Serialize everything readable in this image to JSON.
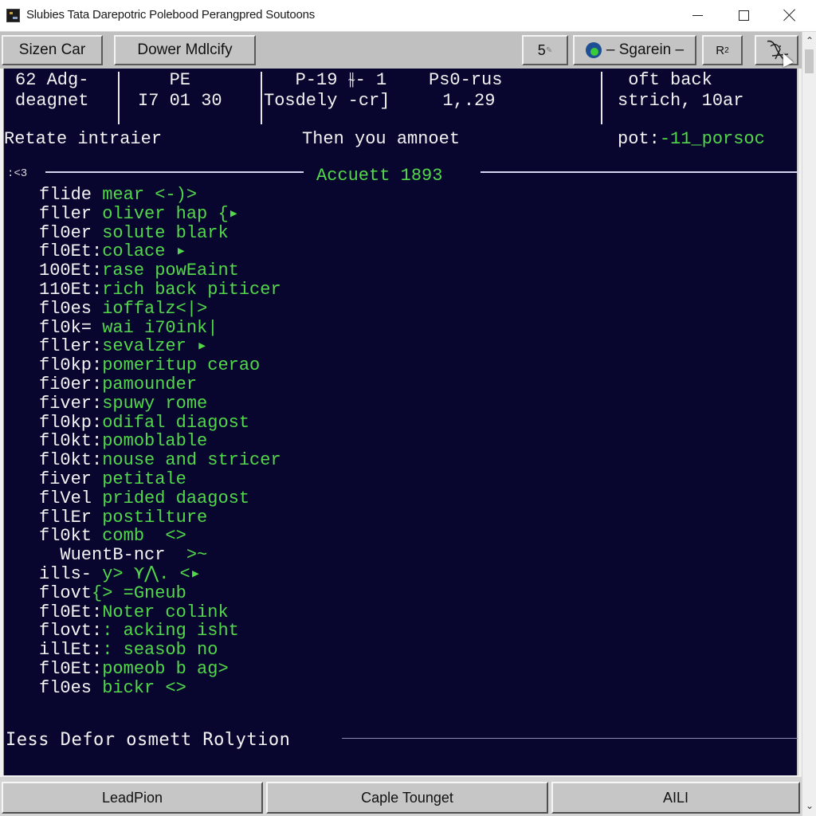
{
  "window": {
    "title": "Slubies Tata Darepotric Polebood Perangpred Soutoons",
    "icon": "app-icon",
    "controls": {
      "minimize": "minimize-icon",
      "maximize": "maximize-icon",
      "close": "close-icon"
    }
  },
  "toolbar": {
    "buttons": [
      {
        "label": "Sizen Car"
      },
      {
        "label": "Dower Mdlcify"
      },
      {
        "label": "5",
        "icon": "pencil-icon"
      },
      {
        "label": "– Sgarein –",
        "icon": "gear-icon"
      },
      {
        "label": "R",
        "sub": "2"
      },
      {
        "label": "",
        "icon": "edit-tool-icon"
      }
    ]
  },
  "terminal": {
    "header": [
      {
        "lines": "62 Adg-\ndeagnet"
      },
      {
        "lines": "   PE\nI7 01 30"
      },
      {
        "lines": "   P-19 ⫳- 1    Ps0-rus\nTosdely -cr]     1,.29"
      },
      {
        "lines": " oft back\nstrich, 10ar"
      }
    ],
    "info": {
      "left": "Retate intraier",
      "middle": "Then you amnoet",
      "right_label": "pot:",
      "right_value": "-11_porsoc"
    },
    "section": {
      "prefix": ":<3",
      "title": "Accuett 1893"
    },
    "rows": [
      {
        "key": "flide ",
        "value": "mear <-)>"
      },
      {
        "key": "fller ",
        "value": "oliver hap {▸"
      },
      {
        "key": "fl0er ",
        "value": "solute blark"
      },
      {
        "key": "fl0Et:",
        "value": "colace ▸"
      },
      {
        "key": "100Et:",
        "value": "rase powEaint"
      },
      {
        "key": "110Et:",
        "value": "rich back piticer"
      },
      {
        "key": "fl0es ",
        "value": "ioffalz<|>"
      },
      {
        "key": "fl0k= ",
        "value": "wai i70ink|"
      },
      {
        "key": "fller:",
        "value": "sevalzer ▸"
      },
      {
        "key": "fl0kp:",
        "value": "pomeritup cerao"
      },
      {
        "key": "fi0er:",
        "value": "pamounder"
      },
      {
        "key": "fiver:",
        "value": "spuwy rome"
      },
      {
        "key": "fl0kp:",
        "value": "odifal diagost"
      },
      {
        "key": "fl0kt:",
        "value": "pomoblable"
      },
      {
        "key": "fl0kt:",
        "value": "nouse and stricer"
      },
      {
        "key": "fiver ",
        "value": "petitale"
      },
      {
        "key": "flVel ",
        "value": "prided daagost"
      },
      {
        "key": "fllEr ",
        "value": "postilture"
      },
      {
        "key": "fl0kt ",
        "value": "comb  <>"
      },
      {
        "key": "  WuentB-ncr  ",
        "value": ">~"
      },
      {
        "key": "ills- ",
        "value": "y> ⋎⋀. <▸"
      },
      {
        "key": "flovt",
        "value": "{> =Gneub"
      },
      {
        "key": "fl0Et:",
        "value": "Noter colink"
      },
      {
        "key": "flovt:",
        "value": ": acking isht"
      },
      {
        "key": "illEt:",
        "value": ": seasob no"
      },
      {
        "key": "fl0Et:",
        "value": "pomeob b ag>"
      },
      {
        "key": "fl0es ",
        "value": "bickr <>"
      }
    ],
    "footer": "Iess Defor osmett Rolytion"
  },
  "bottombar": {
    "buttons": [
      {
        "label": "LeadPion"
      },
      {
        "label": "Caple Tounget"
      },
      {
        "label": "AILI"
      }
    ]
  },
  "colors": {
    "terminal_bg": "#08062e",
    "terminal_fg": "#f2f2f2",
    "accent_green": "#52d84a",
    "toolbar_bg": "#c0c0c0"
  }
}
